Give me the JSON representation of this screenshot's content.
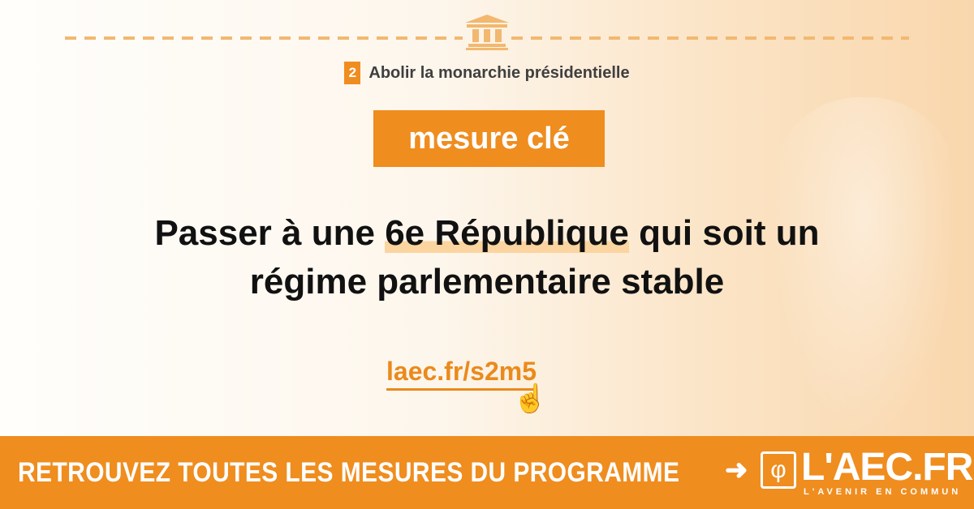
{
  "category": {
    "number": "2",
    "label": "Abolir la monarchie présidentielle"
  },
  "badge": "mesure clé",
  "headline": {
    "before": "Passer à une ",
    "highlight": "6e République",
    "after": " qui soit un",
    "line2": "régime parlementaire stable"
  },
  "link": "laec.fr/s2m5",
  "banner": {
    "cta": "RETROUVEZ TOUTES LES MESURES DU PROGRAMME",
    "logo": "L'AEC.FR",
    "logo_sub": "L'AVENIR EN COMMUN"
  },
  "colors": {
    "accent": "#ef8d1f",
    "highlight": "#fbd4a0"
  }
}
